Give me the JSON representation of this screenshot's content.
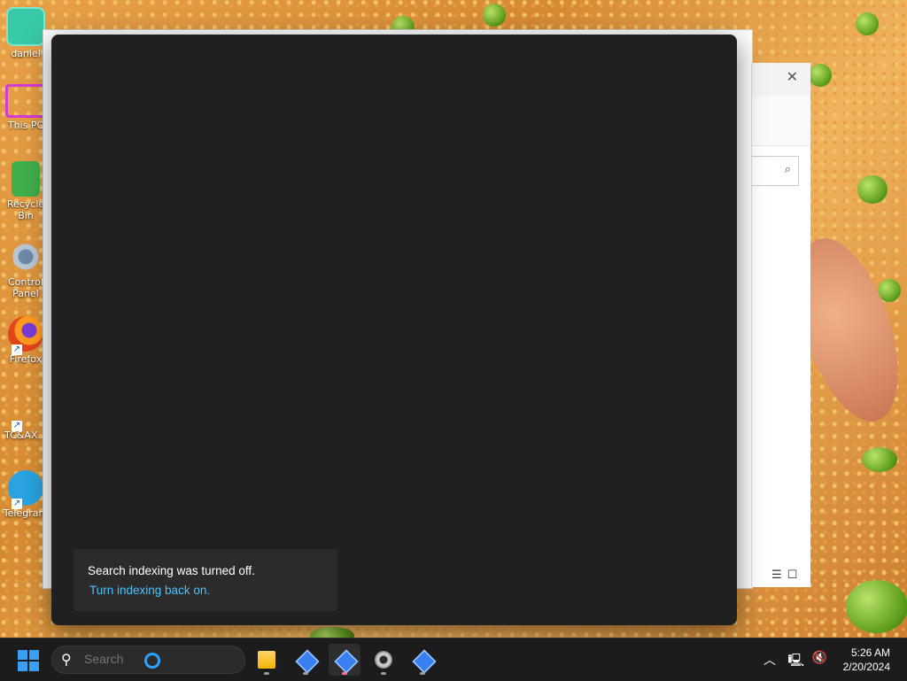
{
  "desktop": {
    "icons": [
      {
        "label": "daniel",
        "icon": "user-folder-icon"
      },
      {
        "label": "This PC",
        "icon": "monitor-icon"
      },
      {
        "label": "Recycle Bin",
        "icon": "recycle-bin-icon"
      },
      {
        "label": "Control Panel",
        "icon": "control-panel-icon"
      },
      {
        "label": "Firefox",
        "icon": "firefox-icon"
      },
      {
        "label": "TC&AX...",
        "icon": "app-icon"
      },
      {
        "label": "Telegram",
        "icon": "telegram-icon"
      }
    ]
  },
  "explorer": {
    "close_glyph": "✕",
    "search_glyph": "⌕",
    "view_glyphs": "☰☐"
  },
  "search_flyout": {
    "notice_text": "Search indexing was turned off.",
    "notice_link": "Turn indexing back on."
  },
  "taskbar": {
    "search_placeholder": "Search",
    "apps": [
      "file-explorer-icon",
      "app-diamond-icon",
      "app-diamond-icon",
      "settings-gear-icon",
      "app-diamond-icon"
    ],
    "tray": {
      "chevron": "︿",
      "network": "🖳",
      "volume": "🔇"
    },
    "clock": {
      "time": "5:26 AM",
      "date": "2/20/2024"
    }
  },
  "colors": {
    "flyout_bg": "#202020",
    "link": "#4cc2ff",
    "taskbar_bg": "#1c1c1c",
    "accent": "#3aa0f3"
  }
}
